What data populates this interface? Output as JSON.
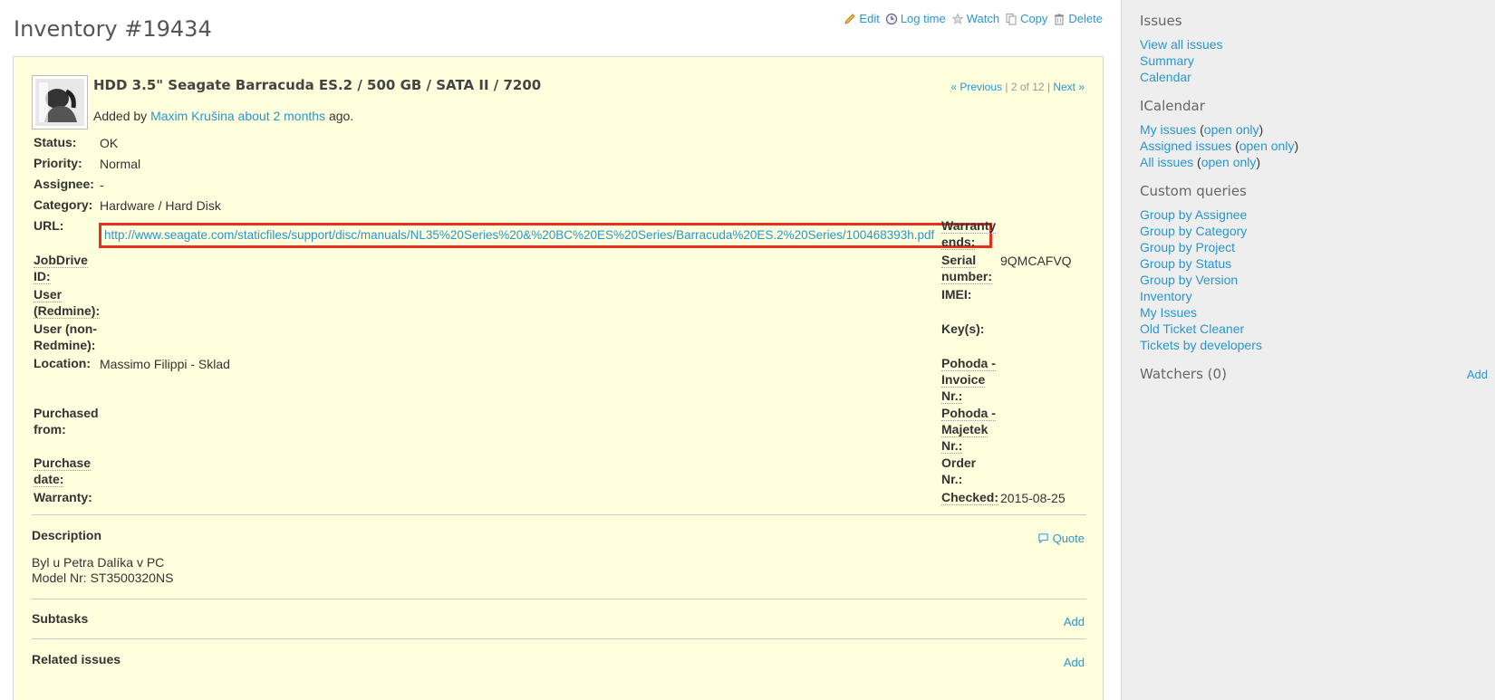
{
  "title": "Inventory #19434",
  "actions": {
    "edit": "Edit",
    "log_time": "Log time",
    "watch": "Watch",
    "copy": "Copy",
    "delete": "Delete"
  },
  "issue": {
    "subject": "HDD 3.5\" Seagate Barracuda ES.2 / 500 GB / SATA II / 7200",
    "added_by_prefix": "Added by",
    "author": "Maxim Krušina",
    "time_ago": "about 2 months",
    "added_suffix": "ago.",
    "nav": {
      "previous": "« Previous",
      "position": "2 of 12",
      "next": "Next »"
    },
    "left_labels": {
      "status": "Status:",
      "priority": "Priority:",
      "assignee": "Assignee:",
      "category": "Category:",
      "url": "URL:",
      "jobdrive_a": "JobDrive",
      "jobdrive_b": "ID:",
      "user_redmine_a": "User",
      "user_redmine_b": "(Redmine):",
      "user_nonredmine_a": "User (non-",
      "user_nonredmine_b": "Redmine):",
      "location": "Location:",
      "purchased_a": "Purchased",
      "purchased_b": "from:",
      "purchase_date_a": "Purchase",
      "purchase_date_b": "date:",
      "warranty": "Warranty:"
    },
    "left_values": {
      "status": "OK",
      "priority": "Normal",
      "assignee": "-",
      "category": "Hardware / Hard Disk",
      "url": "http://www.seagate.com/staticfiles/support/disc/manuals/NL35%20Series%20&%20BC%20ES%20Series/Barracuda%20ES.2%20Series/100468393h.pdf",
      "location": "Massimo Filippi - Sklad"
    },
    "right_labels": {
      "warranty_ends_a": "Warranty",
      "warranty_ends_b": "ends:",
      "serial_a": "Serial",
      "serial_b": "number:",
      "imei": "IMEI:",
      "keys": "Key(s):",
      "pohoda_invoice_a": "Pohoda -",
      "pohoda_invoice_b": "Invoice",
      "pohoda_invoice_c": "Nr.:",
      "pohoda_majetek_a": "Pohoda -",
      "pohoda_majetek_b": "Majetek",
      "pohoda_majetek_c": "Nr.:",
      "order_a": "Order",
      "order_b": "Nr.:",
      "checked": "Checked:"
    },
    "right_values": {
      "serial": "9QMCAFVQ",
      "checked": "2015-08-25"
    },
    "description": {
      "heading": "Description",
      "quote": "Quote",
      "line1": "Byl u Petra Dalíka v PC",
      "line2": "Model Nr: ST3500320NS"
    },
    "subtasks": {
      "heading": "Subtasks",
      "add": "Add"
    },
    "related": {
      "heading": "Related issues",
      "add": "Add"
    }
  },
  "sidebar": {
    "issues": {
      "heading": "Issues",
      "items": [
        "View all issues",
        "Summary",
        "Calendar"
      ]
    },
    "icalendar": {
      "heading": "ICalendar",
      "items": [
        {
          "label": "My issues",
          "extra": "open only"
        },
        {
          "label": "Assigned issues",
          "extra": "open only"
        },
        {
          "label": "All issues",
          "extra": "open only"
        }
      ]
    },
    "custom_queries": {
      "heading": "Custom queries",
      "items": [
        "Group by Assignee",
        "Group by Category",
        "Group by Project",
        "Group by Status",
        "Group by Version",
        "Inventory",
        "My Issues",
        "Old Ticket Cleaner",
        "Tickets by developers"
      ]
    },
    "watchers": {
      "heading": "Watchers (0)",
      "add": "Add"
    }
  },
  "colors": {
    "link": "#2996cc",
    "issue_bg": "#ffffdd",
    "highlight": "#e63020",
    "sidebar_bg": "#eeeeee"
  }
}
